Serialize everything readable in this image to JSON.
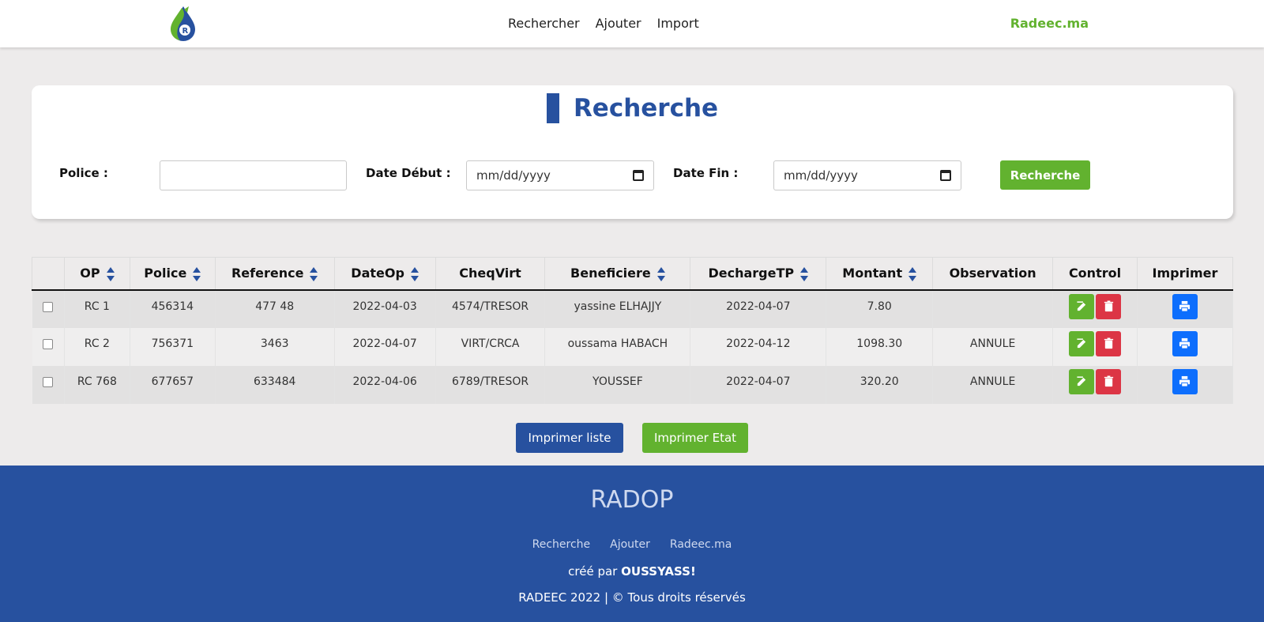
{
  "header": {
    "nav": [
      "Rechercher",
      "Ajouter",
      "Import"
    ],
    "brand": "Radeec.ma"
  },
  "search": {
    "title": "Recherche",
    "police_label": "Police :",
    "police_value": "",
    "date_debut_label": "Date Début :",
    "date_debut_placeholder": "mm/dd/yyyy",
    "date_fin_label": "Date Fin :",
    "date_fin_placeholder": "mm/dd/yyyy",
    "button": "Recherche"
  },
  "table": {
    "columns": [
      "OP",
      "Police",
      "Reference",
      "DateOp",
      "CheqVirt",
      "Beneficiere",
      "DechargeTP",
      "Montant",
      "Observation",
      "Control",
      "Imprimer"
    ],
    "rows": [
      {
        "op": "RC 1",
        "police": "456314",
        "reference": "477 48",
        "dateop": "2022-04-03",
        "cheqvirt": "4574/TRESOR",
        "beneficiere": "yassine ELHAJJY",
        "dechargetp": "2022-04-07",
        "montant": "7.80",
        "observation": ""
      },
      {
        "op": "RC 2",
        "police": "756371",
        "reference": "3463",
        "dateop": "2022-04-07",
        "cheqvirt": "VIRT/CRCA",
        "beneficiere": "oussama HABACH",
        "dechargetp": "2022-04-12",
        "montant": "1098.30",
        "observation": "ANNULE"
      },
      {
        "op": "RC 768",
        "police": "677657",
        "reference": "633484",
        "dateop": "2022-04-06",
        "cheqvirt": "6789/TRESOR",
        "beneficiere": "YOUSSEF",
        "dechargetp": "2022-04-07",
        "montant": "320.20",
        "observation": "ANNULE"
      }
    ]
  },
  "actions": {
    "print_list": "Imprimer liste",
    "print_state": "Imprimer Etat"
  },
  "footer": {
    "title": "RADOP",
    "links": [
      "Recherche",
      "Ajouter",
      "Radeec.ma"
    ],
    "created_by_prefix": "créé par",
    "created_by_name": "OUSSYASS!",
    "copyright": "RADEEC 2022 | © Tous droits réservés"
  },
  "colors": {
    "primary_blue": "#27519f",
    "green": "#62b22f",
    "danger": "#dc3545",
    "print_blue": "#0d6efd"
  }
}
